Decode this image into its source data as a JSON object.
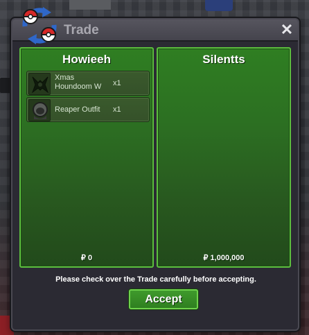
{
  "window": {
    "title": "Trade",
    "close_label": "✕"
  },
  "left_panel": {
    "player": "Howieeh",
    "items": [
      {
        "name": "Xmas Houndoom W",
        "qty": "x1",
        "icon": "houndoom-costume-icon"
      },
      {
        "name": "Reaper Outfit",
        "qty": "x1",
        "icon": "reaper-outfit-icon"
      }
    ],
    "money": "₽ 0"
  },
  "right_panel": {
    "player": "Silentts",
    "items": [],
    "money": "₽ 1,000,000"
  },
  "notice": "Please check over the Trade carefully before accepting.",
  "accept_label": "Accept",
  "colors": {
    "panel_green": "#2c6f22",
    "panel_border": "#5cbf3e",
    "window_bg": "#2b2a33",
    "accept_green": "#3f9a2c"
  }
}
